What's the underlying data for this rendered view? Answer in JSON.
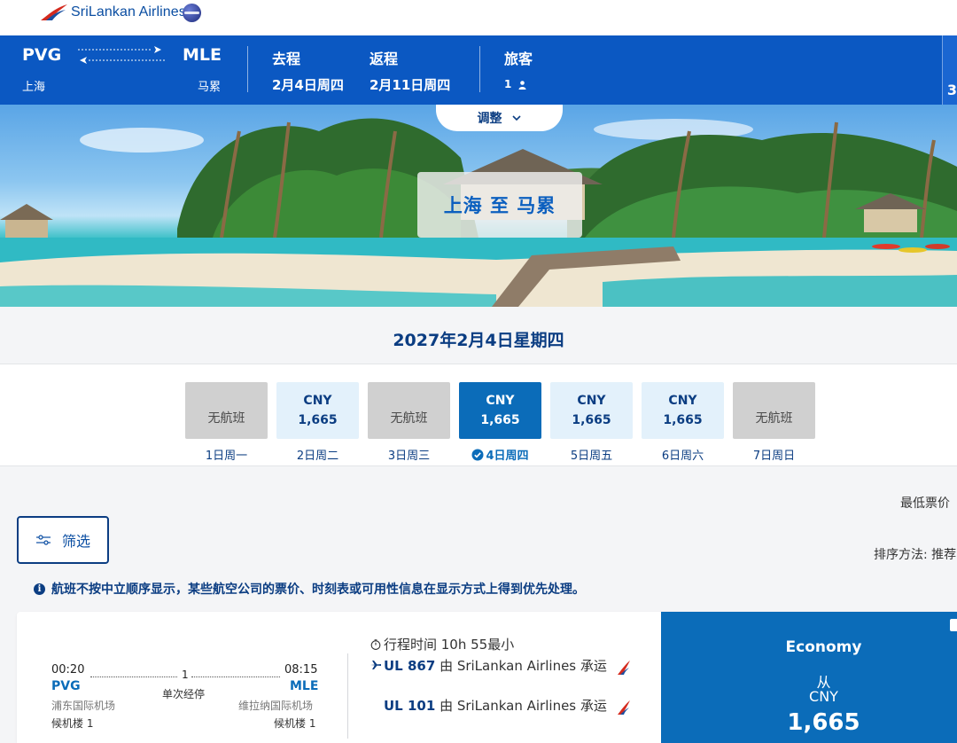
{
  "brand": {
    "name": "SriLankan Airlines",
    "alliance_icon": "oneworld-icon"
  },
  "trip": {
    "origin_code": "PVG",
    "origin_city": "上海",
    "dest_code": "MLE",
    "dest_city": "马累",
    "depart_label": "去程",
    "depart_date": "2月4日周四",
    "return_label": "返程",
    "return_date": "2月11日周四",
    "pax_label": "旅客",
    "pax_count": "1",
    "edge_value": "3"
  },
  "hero": {
    "adjust_label": "调整",
    "title": "上海 至 马累"
  },
  "selected_date_heading": "2027年2月4日星期四",
  "date_carousel": [
    {
      "available": false,
      "text": "无航班",
      "label": "1日周一"
    },
    {
      "available": true,
      "currency": "CNY",
      "price": "1,665",
      "label": "2日周二"
    },
    {
      "available": false,
      "text": "无航班",
      "label": "3日周三"
    },
    {
      "available": true,
      "selected": true,
      "currency": "CNY",
      "price": "1,665",
      "label": "4日周四"
    },
    {
      "available": true,
      "currency": "CNY",
      "price": "1,665",
      "label": "5日周五"
    },
    {
      "available": true,
      "currency": "CNY",
      "price": "1,665",
      "label": "6日周六"
    },
    {
      "available": false,
      "text": "无航班",
      "label": "7日周日"
    }
  ],
  "controls": {
    "lowest_price": "最低票价",
    "filter_label": "筛选",
    "sort_label": "排序方法: 推荐"
  },
  "notice": "航班不按中立顺序显示，某些航空公司的票价、时刻表或可用性信息在显示方式上得到优先处理。",
  "flight": {
    "depart_time": "00:20",
    "depart_code": "PVG",
    "depart_airport": "浦东国际机场",
    "depart_terminal": "候机楼 1",
    "arrive_time": "08:15",
    "arrive_code": "MLE",
    "arrive_airport": "维拉纳国际机场",
    "arrive_terminal": "候机楼 1",
    "stops_count": "1",
    "stops_text": "单次经停",
    "duration": "行程时间 10h 55最小",
    "legs": [
      {
        "flight_no": "UL 867",
        "carrier": "由 SriLankan Airlines 承运"
      },
      {
        "flight_no": "UL 101",
        "carrier": "由 SriLankan Airlines 承运"
      }
    ],
    "fare": {
      "cabin": "Economy",
      "from": "从",
      "currency": "CNY",
      "price": "1,665"
    }
  },
  "colors": {
    "brand_blue": "#0b58c2",
    "selected_blue": "#0b6cb9",
    "navy": "#0b3d82",
    "tail_red": "#d42a1e"
  }
}
